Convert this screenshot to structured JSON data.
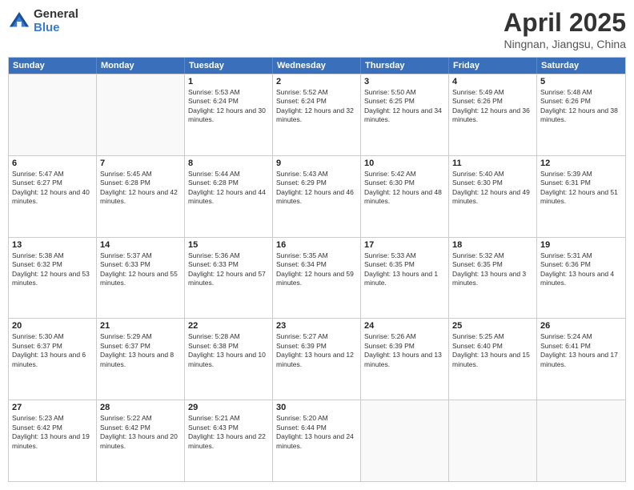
{
  "header": {
    "logo_line1": "General",
    "logo_line2": "Blue",
    "title": "April 2025",
    "subtitle": "Ningnan, Jiangsu, China"
  },
  "weekdays": [
    "Sunday",
    "Monday",
    "Tuesday",
    "Wednesday",
    "Thursday",
    "Friday",
    "Saturday"
  ],
  "rows": [
    [
      {
        "day": "",
        "sunrise": "",
        "sunset": "",
        "daylight": ""
      },
      {
        "day": "",
        "sunrise": "",
        "sunset": "",
        "daylight": ""
      },
      {
        "day": "1",
        "sunrise": "Sunrise: 5:53 AM",
        "sunset": "Sunset: 6:24 PM",
        "daylight": "Daylight: 12 hours and 30 minutes."
      },
      {
        "day": "2",
        "sunrise": "Sunrise: 5:52 AM",
        "sunset": "Sunset: 6:24 PM",
        "daylight": "Daylight: 12 hours and 32 minutes."
      },
      {
        "day": "3",
        "sunrise": "Sunrise: 5:50 AM",
        "sunset": "Sunset: 6:25 PM",
        "daylight": "Daylight: 12 hours and 34 minutes."
      },
      {
        "day": "4",
        "sunrise": "Sunrise: 5:49 AM",
        "sunset": "Sunset: 6:26 PM",
        "daylight": "Daylight: 12 hours and 36 minutes."
      },
      {
        "day": "5",
        "sunrise": "Sunrise: 5:48 AM",
        "sunset": "Sunset: 6:26 PM",
        "daylight": "Daylight: 12 hours and 38 minutes."
      }
    ],
    [
      {
        "day": "6",
        "sunrise": "Sunrise: 5:47 AM",
        "sunset": "Sunset: 6:27 PM",
        "daylight": "Daylight: 12 hours and 40 minutes."
      },
      {
        "day": "7",
        "sunrise": "Sunrise: 5:45 AM",
        "sunset": "Sunset: 6:28 PM",
        "daylight": "Daylight: 12 hours and 42 minutes."
      },
      {
        "day": "8",
        "sunrise": "Sunrise: 5:44 AM",
        "sunset": "Sunset: 6:28 PM",
        "daylight": "Daylight: 12 hours and 44 minutes."
      },
      {
        "day": "9",
        "sunrise": "Sunrise: 5:43 AM",
        "sunset": "Sunset: 6:29 PM",
        "daylight": "Daylight: 12 hours and 46 minutes."
      },
      {
        "day": "10",
        "sunrise": "Sunrise: 5:42 AM",
        "sunset": "Sunset: 6:30 PM",
        "daylight": "Daylight: 12 hours and 48 minutes."
      },
      {
        "day": "11",
        "sunrise": "Sunrise: 5:40 AM",
        "sunset": "Sunset: 6:30 PM",
        "daylight": "Daylight: 12 hours and 49 minutes."
      },
      {
        "day": "12",
        "sunrise": "Sunrise: 5:39 AM",
        "sunset": "Sunset: 6:31 PM",
        "daylight": "Daylight: 12 hours and 51 minutes."
      }
    ],
    [
      {
        "day": "13",
        "sunrise": "Sunrise: 5:38 AM",
        "sunset": "Sunset: 6:32 PM",
        "daylight": "Daylight: 12 hours and 53 minutes."
      },
      {
        "day": "14",
        "sunrise": "Sunrise: 5:37 AM",
        "sunset": "Sunset: 6:33 PM",
        "daylight": "Daylight: 12 hours and 55 minutes."
      },
      {
        "day": "15",
        "sunrise": "Sunrise: 5:36 AM",
        "sunset": "Sunset: 6:33 PM",
        "daylight": "Daylight: 12 hours and 57 minutes."
      },
      {
        "day": "16",
        "sunrise": "Sunrise: 5:35 AM",
        "sunset": "Sunset: 6:34 PM",
        "daylight": "Daylight: 12 hours and 59 minutes."
      },
      {
        "day": "17",
        "sunrise": "Sunrise: 5:33 AM",
        "sunset": "Sunset: 6:35 PM",
        "daylight": "Daylight: 13 hours and 1 minute."
      },
      {
        "day": "18",
        "sunrise": "Sunrise: 5:32 AM",
        "sunset": "Sunset: 6:35 PM",
        "daylight": "Daylight: 13 hours and 3 minutes."
      },
      {
        "day": "19",
        "sunrise": "Sunrise: 5:31 AM",
        "sunset": "Sunset: 6:36 PM",
        "daylight": "Daylight: 13 hours and 4 minutes."
      }
    ],
    [
      {
        "day": "20",
        "sunrise": "Sunrise: 5:30 AM",
        "sunset": "Sunset: 6:37 PM",
        "daylight": "Daylight: 13 hours and 6 minutes."
      },
      {
        "day": "21",
        "sunrise": "Sunrise: 5:29 AM",
        "sunset": "Sunset: 6:37 PM",
        "daylight": "Daylight: 13 hours and 8 minutes."
      },
      {
        "day": "22",
        "sunrise": "Sunrise: 5:28 AM",
        "sunset": "Sunset: 6:38 PM",
        "daylight": "Daylight: 13 hours and 10 minutes."
      },
      {
        "day": "23",
        "sunrise": "Sunrise: 5:27 AM",
        "sunset": "Sunset: 6:39 PM",
        "daylight": "Daylight: 13 hours and 12 minutes."
      },
      {
        "day": "24",
        "sunrise": "Sunrise: 5:26 AM",
        "sunset": "Sunset: 6:39 PM",
        "daylight": "Daylight: 13 hours and 13 minutes."
      },
      {
        "day": "25",
        "sunrise": "Sunrise: 5:25 AM",
        "sunset": "Sunset: 6:40 PM",
        "daylight": "Daylight: 13 hours and 15 minutes."
      },
      {
        "day": "26",
        "sunrise": "Sunrise: 5:24 AM",
        "sunset": "Sunset: 6:41 PM",
        "daylight": "Daylight: 13 hours and 17 minutes."
      }
    ],
    [
      {
        "day": "27",
        "sunrise": "Sunrise: 5:23 AM",
        "sunset": "Sunset: 6:42 PM",
        "daylight": "Daylight: 13 hours and 19 minutes."
      },
      {
        "day": "28",
        "sunrise": "Sunrise: 5:22 AM",
        "sunset": "Sunset: 6:42 PM",
        "daylight": "Daylight: 13 hours and 20 minutes."
      },
      {
        "day": "29",
        "sunrise": "Sunrise: 5:21 AM",
        "sunset": "Sunset: 6:43 PM",
        "daylight": "Daylight: 13 hours and 22 minutes."
      },
      {
        "day": "30",
        "sunrise": "Sunrise: 5:20 AM",
        "sunset": "Sunset: 6:44 PM",
        "daylight": "Daylight: 13 hours and 24 minutes."
      },
      {
        "day": "",
        "sunrise": "",
        "sunset": "",
        "daylight": ""
      },
      {
        "day": "",
        "sunrise": "",
        "sunset": "",
        "daylight": ""
      },
      {
        "day": "",
        "sunrise": "",
        "sunset": "",
        "daylight": ""
      }
    ]
  ]
}
